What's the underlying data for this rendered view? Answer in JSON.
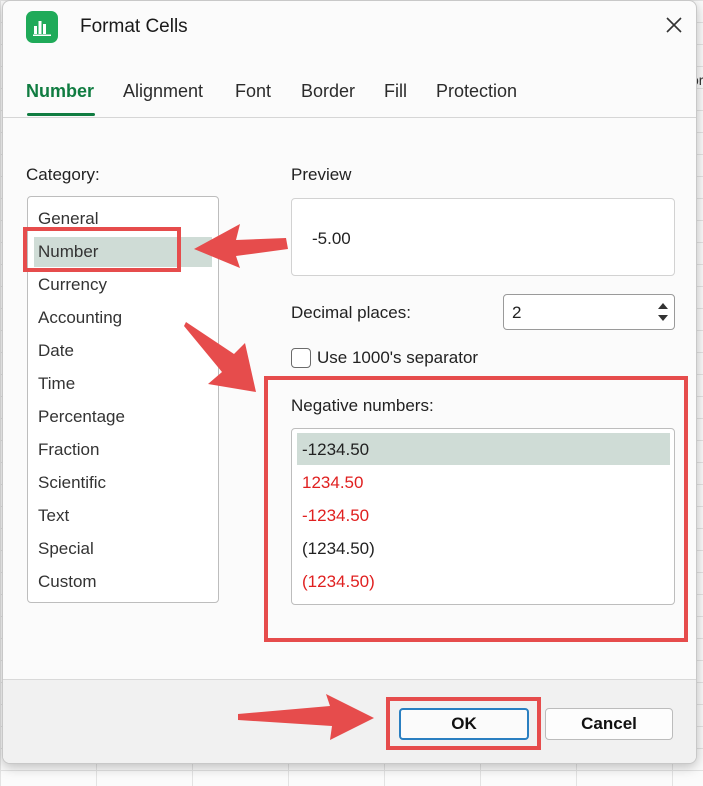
{
  "window": {
    "title": "Format Cells",
    "app_icon": "spreadsheet-app-icon",
    "close_icon": "close-icon"
  },
  "background": {
    "edge_text": "or\nr"
  },
  "tabs": [
    {
      "label": "Number",
      "active": true
    },
    {
      "label": "Alignment",
      "active": false
    },
    {
      "label": "Font",
      "active": false
    },
    {
      "label": "Border",
      "active": false
    },
    {
      "label": "Fill",
      "active": false
    },
    {
      "label": "Protection",
      "active": false
    }
  ],
  "category": {
    "label": "Category:",
    "items": [
      "General",
      "Number",
      "Currency",
      "Accounting",
      "Date",
      "Time",
      "Percentage",
      "Fraction",
      "Scientific",
      "Text",
      "Special",
      "Custom"
    ],
    "selected": "Number"
  },
  "preview": {
    "label": "Preview",
    "value": "-5.00"
  },
  "decimal_places": {
    "label": "Decimal places:",
    "value": "2"
  },
  "separator": {
    "label": "Use 1000's separator",
    "checked": false
  },
  "negative_numbers": {
    "label": "Negative numbers:",
    "items": [
      {
        "text": "-1234.50",
        "color": "#222222",
        "selected": true
      },
      {
        "text": "1234.50",
        "color": "#e02020",
        "selected": false
      },
      {
        "text": "-1234.50",
        "color": "#e02020",
        "selected": false
      },
      {
        "text": "(1234.50)",
        "color": "#222222",
        "selected": false
      },
      {
        "text": "(1234.50)",
        "color": "#e02020",
        "selected": false
      }
    ]
  },
  "buttons": {
    "ok": "OK",
    "cancel": "Cancel"
  },
  "colors": {
    "accent": "#107c41",
    "annotation": "#e64c4c",
    "selection": "#cfdcd6",
    "negative_red": "#e02020"
  }
}
